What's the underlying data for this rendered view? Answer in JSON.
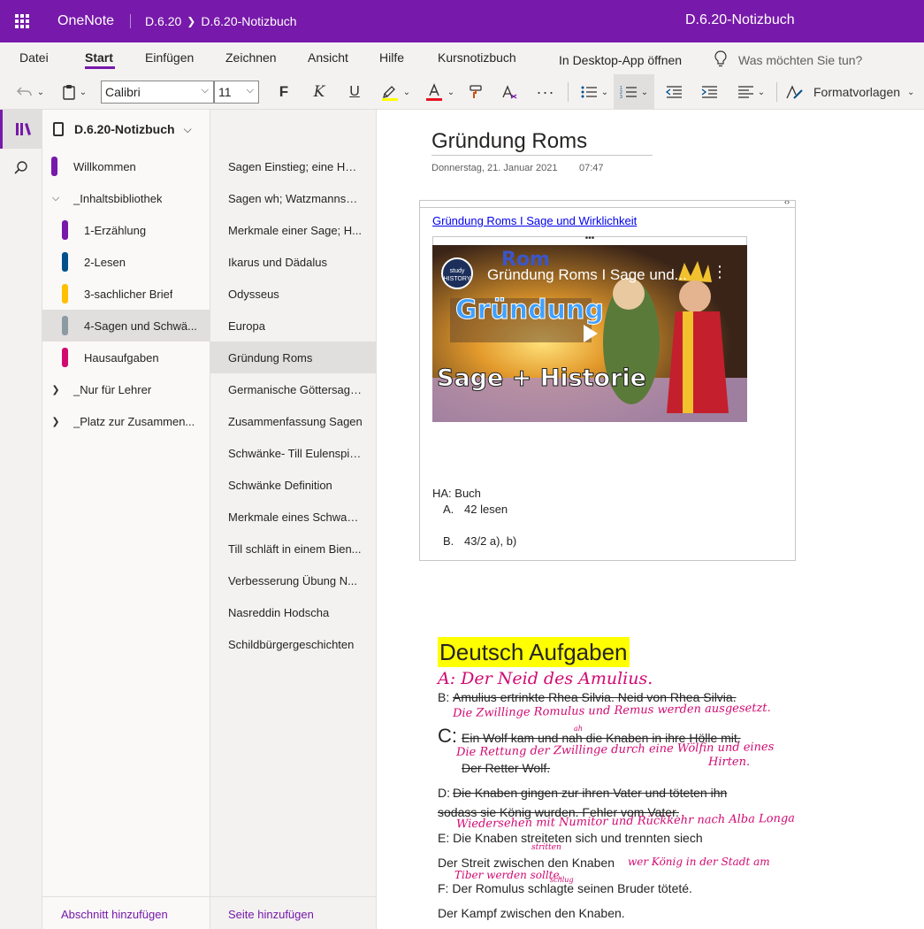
{
  "titlebar": {
    "app": "OneNote",
    "breadcrumb_1": "D.6.20",
    "breadcrumb_2": "D.6.20-Notizbuch",
    "doc_title": "D.6.20-Notizbuch",
    "accent_color": "#7719aa"
  },
  "ribbon": {
    "tabs": [
      "Datei",
      "Start",
      "Einfügen",
      "Zeichnen",
      "Ansicht",
      "Hilfe",
      "Kursnotizbuch"
    ],
    "active_tab": "Start",
    "open_desktop": "In Desktop-App öffnen",
    "tell_me": "Was möchten Sie tun?",
    "font_name": "Calibri",
    "font_size": "11",
    "styles": "Formatvorlagen"
  },
  "notebook": {
    "name": "D.6.20-Notizbuch",
    "add_section": "Abschnitt hinzufügen",
    "add_page": "Seite hinzufügen",
    "sections": [
      {
        "label": "Willkommen",
        "color": "#7719aa"
      },
      {
        "label": "_Inhaltsbibliothek",
        "group": "expanded"
      },
      {
        "label": "1-Erzählung",
        "color": "#7719aa"
      },
      {
        "label": "2-Lesen",
        "color": "#00508c"
      },
      {
        "label": "3-sachlicher Brief",
        "color": "#ffc000"
      },
      {
        "label": "4-Sagen und Schwä...",
        "color": "#8c9aa3",
        "selected": true
      },
      {
        "label": "Hausaufgaben",
        "color": "#d10a72"
      },
      {
        "label": "_Nur für Lehrer",
        "group": "collapsed"
      },
      {
        "label": "_Platz zur Zusammen...",
        "group": "collapsed"
      }
    ],
    "pages": [
      "Sagen Einstieg; eine Hei...",
      "Sagen wh; Watzmannsage",
      "Merkmale einer Sage; H...",
      "Ikarus und Dädalus",
      "Odysseus",
      "Europa",
      "Gründung Roms",
      "Germanische Göttersagen",
      "Zusammenfassung Sagen",
      "Schwänke- Till Eulenspie...",
      "Schwänke Definition",
      "Merkmale eines Schwanks",
      "Till schläft in einem Bien...",
      "Verbesserung Übung N...",
      "Nasreddin Hodscha",
      "Schildbürgergeschichten"
    ],
    "selected_page": "Gründung Roms"
  },
  "page": {
    "title": "Gründung Roms",
    "date": "Donnerstag, 21. Januar 2021",
    "time": "07:47",
    "video_link": "Gründung Roms I Sage und Wirklichkeit",
    "video": {
      "title": "Gründung Roms I Sage und...",
      "word_top": "Gründung",
      "word_bottom": "Sage + Historie",
      "overlay_small": "Rom",
      "channel_badge": "study HISTORY"
    },
    "homework": {
      "label": "HA: Buch",
      "items": [
        {
          "marker": "A.",
          "text": "42 lesen"
        },
        {
          "marker": "B.",
          "text": "43/2 a), b)"
        }
      ]
    },
    "task_title": "Deutsch Aufgaben",
    "typed_lines": {
      "b_prefix": "B:",
      "b_struck": "Amulius ertrinkte Rhea Silvia. Neid von Rhea Silvia.",
      "c_prefix": "C:",
      "c_struck": "Ein Wolf kam und nah die Knaben in ihre Hölle mit.",
      "c_struck2": "Der Retter Wolf.",
      "d_prefix": "D:",
      "d_struck": "Die Knaben gingen zur ihren Vater und töteten ihn",
      "d_struck2": "sodass sie König wurden. Fehler vom Vater.",
      "e_text": "E: Die Knaben streiteten sich und trennten siech",
      "e_text2": "Der Streit zwischen den Knaben",
      "f_text": "F:  Der Romulus schlagte seinen Bruder töteté.",
      "g_text": "Der Kampf zwischen den Knaben."
    },
    "ink": {
      "a": "A: Der Neid des Amulius.",
      "b": "Die Zwillinge Romulus und Remus werden ausgesetzt.",
      "c1": "Die Rettung der Zwillinge durch eine Wölfin und eines",
      "c2": "Hirten.",
      "c_small": "ah",
      "d": "Wiedersehen mit Numitor und Rückkehr nach Alba Longa",
      "e_small": "stritten",
      "e_tail": "wer König in der Stadt am",
      "e_tail2": "Tiber werden sollte.",
      "f_small": "schlug",
      "ink_color": "#d10a72"
    }
  }
}
